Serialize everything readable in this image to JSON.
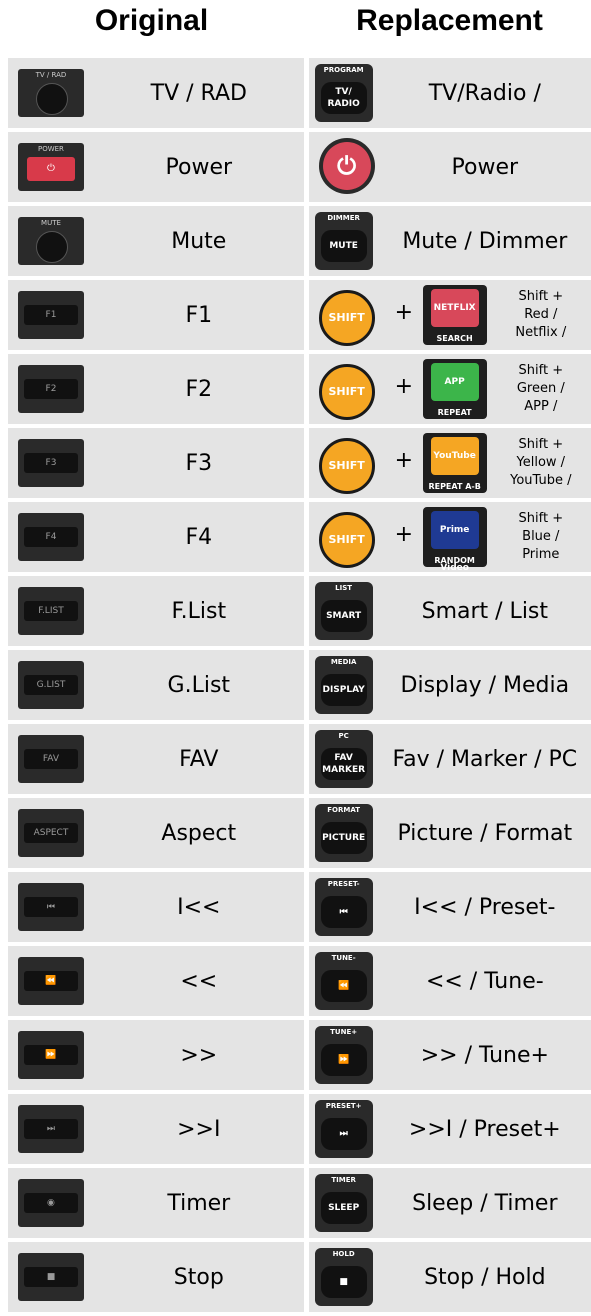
{
  "header": {
    "original": "Original",
    "replacement": "Replacement"
  },
  "rows": [
    {
      "orig_icon": "TV / RAD",
      "orig_label": "TV / RAD",
      "repl_top": "PROGRAM",
      "repl_btn": "TV/ RADIO",
      "repl_label": "TV/Radio /"
    },
    {
      "orig_icon": "POWER",
      "orig_label": "Power",
      "repl_label": "Power"
    },
    {
      "orig_icon": "MUTE",
      "orig_label": "Mute",
      "repl_top": "DIMMER",
      "repl_btn": "MUTE",
      "repl_label": "Mute / Dimmer"
    },
    {
      "orig_icon": "F1",
      "orig_label": "F1",
      "shift": "SHIFT",
      "plus": "+",
      "color_face": "NETFLIX",
      "color_sub": "SEARCH",
      "repl_label": "Shift +\nRed /\nNetflix /"
    },
    {
      "orig_icon": "F2",
      "orig_label": "F2",
      "shift": "SHIFT",
      "plus": "+",
      "color_face": "APP",
      "color_sub": "REPEAT",
      "repl_label": "Shift +\nGreen /\nAPP /"
    },
    {
      "orig_icon": "F3",
      "orig_label": "F3",
      "shift": "SHIFT",
      "plus": "+",
      "color_face": "YouTube",
      "color_sub": "REPEAT A-B",
      "repl_label": "Shift +\nYellow /\nYouTube /"
    },
    {
      "orig_icon": "F4",
      "orig_label": "F4",
      "shift": "SHIFT",
      "plus": "+",
      "color_face": "Prime Video",
      "color_sub": "RANDOM",
      "repl_label": "Shift +\nBlue /\nPrime"
    },
    {
      "orig_icon": "F.LIST",
      "orig_label": "F.List",
      "repl_top": "LIST",
      "repl_btn": "SMART",
      "repl_label": "Smart / List"
    },
    {
      "orig_icon": "G.LIST",
      "orig_label": "G.List",
      "repl_top": "MEDIA",
      "repl_btn": "DISPLAY",
      "repl_label": "Display / Media"
    },
    {
      "orig_icon": "FAV",
      "orig_label": "FAV",
      "repl_top": "PC",
      "repl_btn": "FAV MARKER",
      "repl_label": "Fav / Marker / PC"
    },
    {
      "orig_icon": "ASPECT",
      "orig_label": "Aspect",
      "repl_top": "FORMAT",
      "repl_btn": "PICTURE",
      "repl_label": "Picture / Format"
    },
    {
      "orig_icon": "⏮",
      "orig_label": "I<<",
      "repl_top": "PRESET-",
      "repl_btn": "⏮",
      "repl_label": "I<< / Preset-"
    },
    {
      "orig_icon": "⏪",
      "orig_label": "<<",
      "repl_top": "TUNE-",
      "repl_btn": "⏪",
      "repl_label": "<< / Tune-"
    },
    {
      "orig_icon": "⏩",
      "orig_label": ">>",
      "repl_top": "TUNE+",
      "repl_btn": "⏩",
      "repl_label": ">> / Tune+"
    },
    {
      "orig_icon": "⏭",
      "orig_label": ">>I",
      "repl_top": "PRESET+",
      "repl_btn": "⏭",
      "repl_label": ">>I / Preset+"
    },
    {
      "orig_icon": "◉",
      "orig_label": "Timer",
      "repl_top": "TIMER",
      "repl_btn": "SLEEP",
      "repl_label": "Sleep / Timer"
    },
    {
      "orig_icon": "■",
      "orig_label": "Stop",
      "repl_top": "HOLD",
      "repl_btn": "■",
      "repl_label": "Stop / Hold"
    }
  ],
  "colors": {
    "red": "#d8485a",
    "green": "#3cb54a",
    "yellow": "#f5a623",
    "blue": "#1f3a93",
    "shift": "#f5a623",
    "cell_bg": "#e4e4e4"
  }
}
